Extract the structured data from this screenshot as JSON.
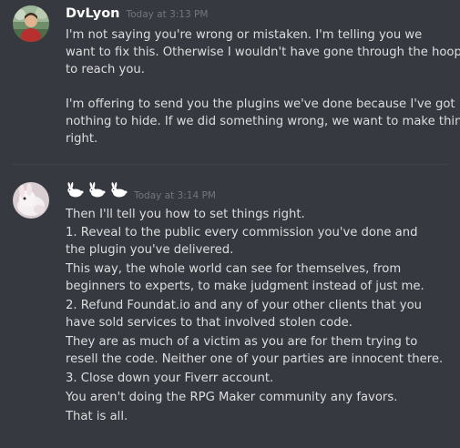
{
  "messages": [
    {
      "username": "DvLyon",
      "timestamp": "Today at 3:13 PM",
      "lines": [
        "I'm not saying you're wrong or mistaken. I'm telling you we",
        "want to fix this. Otherwise I wouldn't have gone through the hoops",
        "to reach you.",
        "",
        "I'm offering to send you the plugins we've done because I've got",
        "nothing to hide. If we did something wrong, we want to make things",
        "right."
      ]
    },
    {
      "username_icons": [
        "rabbit-emoji",
        "rabbit-emoji",
        "rabbit-emoji"
      ],
      "timestamp": "Today at 3:14 PM",
      "lines": [
        "Then I'll tell you how to set things right.",
        "1. Reveal to the public every commission you've done and",
        "the plugin you've delivered.",
        "This way, the whole world can see for themselves, from",
        "beginners to experts, to make judgment instead of just me.",
        "2. Refund Foundat.io and any of your other clients that you",
        "have sold services to that involved stolen code.",
        "They are as much of a victim as you are for them trying to",
        "resell the code. Neither one of your parties are innocent there.",
        "3. Close down your Fiverr account.",
        "You aren't doing the RPG Maker community any favors.",
        "That is all."
      ]
    }
  ],
  "colors": {
    "background": "#36393f",
    "username": "#ffffff",
    "timestamp": "#72767d",
    "text": "#dcddde",
    "divider": "#42454a"
  }
}
